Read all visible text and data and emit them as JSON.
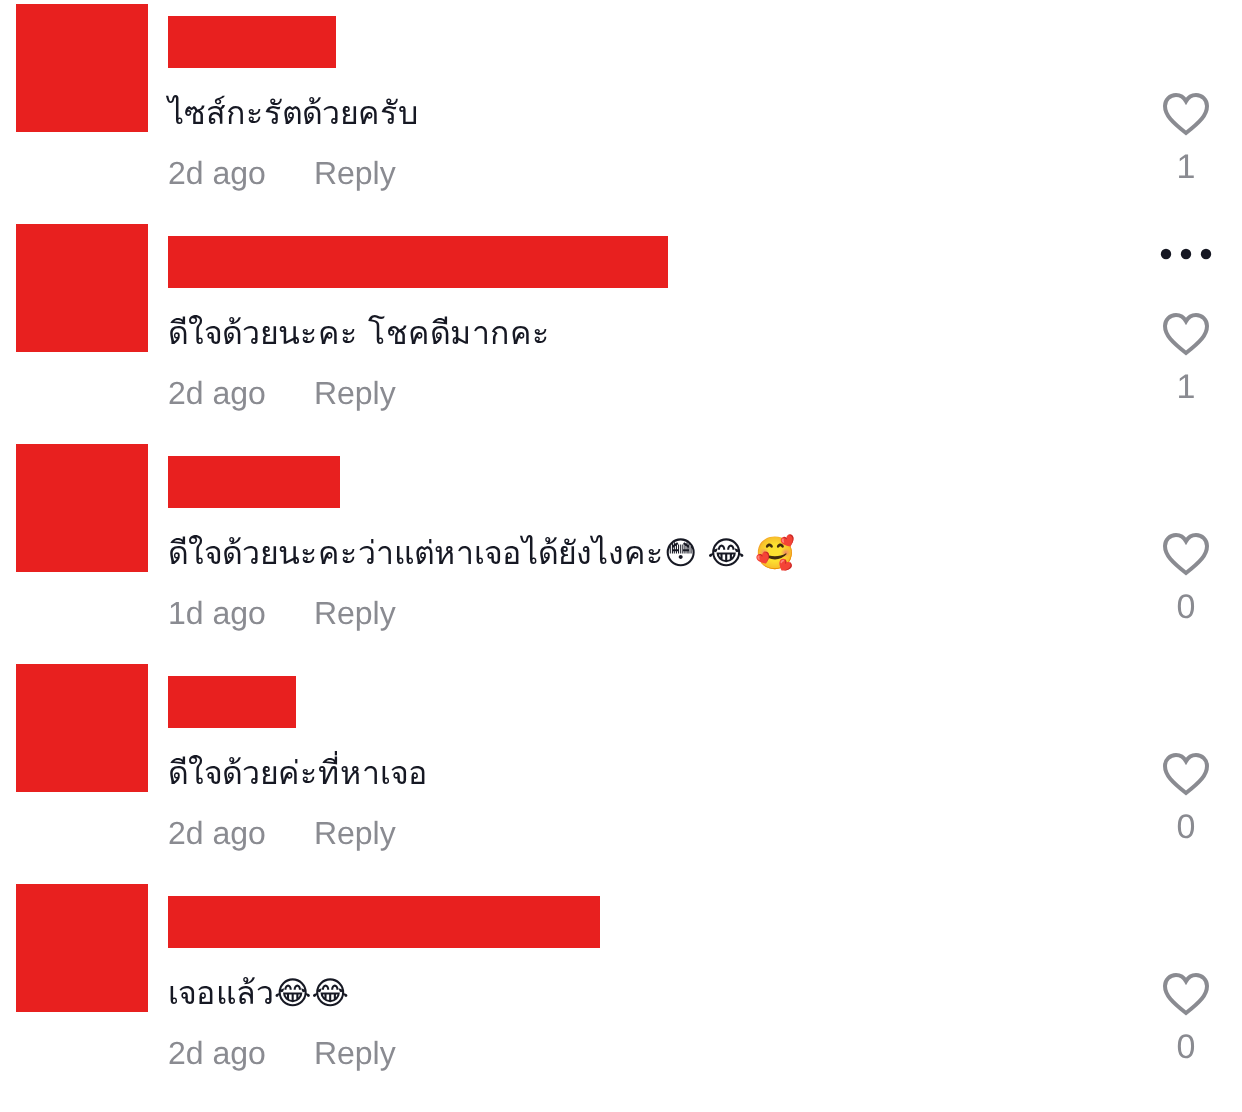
{
  "comments": [
    {
      "text": "ไซส์กะรัตด้วยครับ",
      "time": "2d ago",
      "reply": "Reply",
      "liked": false,
      "likes": "1",
      "more_menu": false
    },
    {
      "text": "ดีใจด้วยนะคะ โชคดีมากคะ",
      "time": "2d ago",
      "reply": "Reply",
      "liked": false,
      "likes": "1",
      "more_menu": true
    },
    {
      "text": "ดีใจด้วยนะคะว่าแต่หาเจอได้ยังไงคะ😳 😂 🥰",
      "time": "1d ago",
      "reply": "Reply",
      "liked": false,
      "likes": "0",
      "more_menu": false
    },
    {
      "text": "ดีใจด้วยค่ะที่หาเจอ",
      "time": "2d ago",
      "reply": "Reply",
      "liked": false,
      "likes": "0",
      "more_menu": false
    },
    {
      "text": "เจอแล้ว😂😂",
      "time": "2d ago",
      "reply": "Reply",
      "liked": false,
      "likes": "0",
      "more_menu": false
    }
  ]
}
